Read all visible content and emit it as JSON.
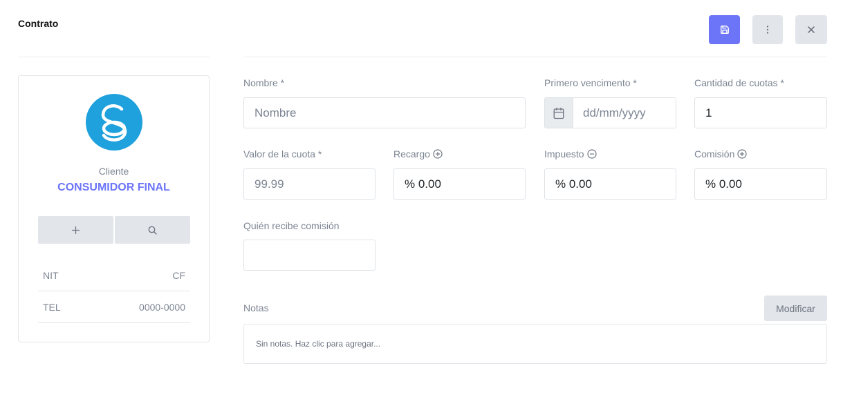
{
  "header": {
    "title": "Contrato"
  },
  "toolbar": {
    "save_icon": "floppy-disk-icon",
    "more_icon": "vertical-dots-icon",
    "close_icon": "close-icon",
    "accent_color": "#6c74f7"
  },
  "client_card": {
    "logo_icon": "brand-logo-icon",
    "logo_color": "#1ea1dc",
    "label": "Cliente",
    "name": "CONSUMIDOR FINAL",
    "add_icon": "plus-icon",
    "search_icon": "search-icon",
    "rows": [
      {
        "key": "NIT",
        "value": "CF"
      },
      {
        "key": "TEL",
        "value": "0000-0000"
      }
    ]
  },
  "form": {
    "nombre": {
      "label": "Nombre *",
      "placeholder": "Nombre",
      "value": ""
    },
    "primer_vencimiento": {
      "label": "Primero vencimento *",
      "placeholder": "dd/mm/yyyy",
      "value": "",
      "icon": "calendar-icon"
    },
    "cantidad_cuotas": {
      "label": "Cantidad de cuotas *",
      "value": "1"
    },
    "valor_cuota": {
      "label": "Valor de la cuota *",
      "placeholder": "99.99",
      "value": ""
    },
    "recargo": {
      "label": "Recargo",
      "value": "% 0.00",
      "icon": "plus-circle-icon"
    },
    "impuesto": {
      "label": "Impuesto",
      "value": "% 0.00",
      "icon": "minus-circle-icon"
    },
    "comision": {
      "label": "Comisión",
      "value": "% 0.00",
      "icon": "plus-circle-icon"
    },
    "quien_recibe": {
      "label": "Quién recibe comisión",
      "value": ""
    }
  },
  "notes": {
    "label": "Notas",
    "modify_label": "Modificar",
    "placeholder": "Sin notas. Haz clic para agregar..."
  }
}
